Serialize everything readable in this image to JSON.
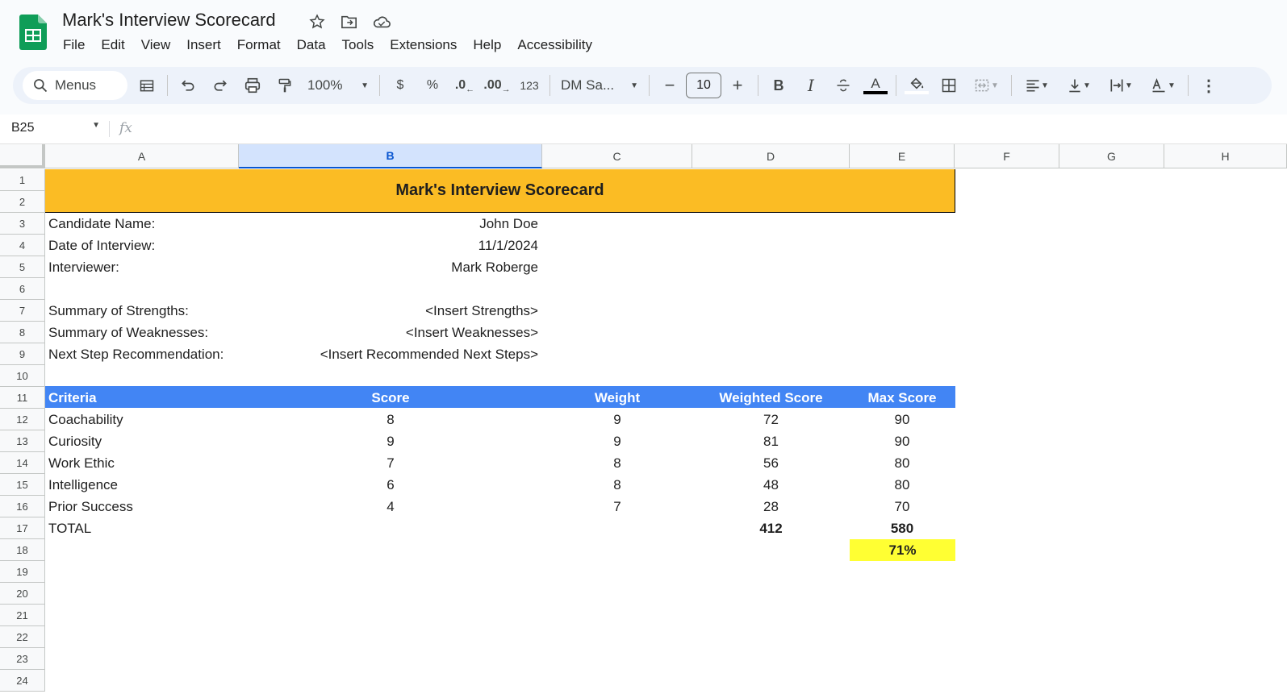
{
  "app": {
    "doc_title": "Mark's Interview Scorecard",
    "menu": [
      "File",
      "Edit",
      "View",
      "Insert",
      "Format",
      "Data",
      "Tools",
      "Extensions",
      "Help",
      "Accessibility"
    ]
  },
  "toolbar": {
    "search_label": "Menus",
    "zoom": "100%",
    "currency": "$",
    "percent": "%",
    "dec_decrease": ".0",
    "dec_increase": ".00",
    "number_format": "123",
    "font": "DM Sa...",
    "font_size": "10",
    "minus": "−",
    "plus": "+",
    "bold": "B",
    "italic": "I",
    "text_color": "A",
    "more": "⋮"
  },
  "formula_bar": {
    "cell_ref": "B25",
    "fx": "fx"
  },
  "columns": [
    "A",
    "B",
    "C",
    "D",
    "E",
    "F",
    "G",
    "H"
  ],
  "selected_column": "B",
  "rows": [
    "1",
    "2",
    "3",
    "4",
    "5",
    "6",
    "7",
    "8",
    "9",
    "10",
    "11",
    "12",
    "13",
    "14",
    "15",
    "16",
    "17",
    "18",
    "19",
    "20",
    "21",
    "22",
    "23",
    "24"
  ],
  "sheet": {
    "banner": "Mark's Interview Scorecard",
    "info": [
      {
        "label": "Candidate Name:",
        "value": "John Doe"
      },
      {
        "label": "Date of Interview:",
        "value": "11/1/2024"
      },
      {
        "label": "Interviewer:",
        "value": "Mark Roberge"
      },
      {
        "label": "Summary of Strengths:",
        "value": "<Insert Strengths>"
      },
      {
        "label": "Summary of Weaknesses:",
        "value": "<Insert Weaknesses>"
      },
      {
        "label": "Next Step Recommendation:",
        "value": "<Insert Recommended Next Steps>"
      }
    ],
    "table_headers": [
      "Criteria",
      "Score",
      "Weight",
      "Weighted Score",
      "Max Score"
    ],
    "table_rows": [
      [
        "Coachability",
        "8",
        "9",
        "72",
        "90"
      ],
      [
        "Curiosity",
        "9",
        "9",
        "81",
        "90"
      ],
      [
        "Work Ethic",
        "7",
        "8",
        "56",
        "80"
      ],
      [
        "Intelligence",
        "6",
        "8",
        "48",
        "80"
      ],
      [
        "Prior Success",
        "4",
        "7",
        "28",
        "70"
      ]
    ],
    "total": {
      "label": "TOTAL",
      "weighted": "412",
      "max": "580"
    },
    "percent": "71%"
  },
  "colors": {
    "banner": "#fbbc24",
    "header": "#4285f4",
    "highlight": "#ffff33",
    "sheets_green": "#0f9d58"
  }
}
